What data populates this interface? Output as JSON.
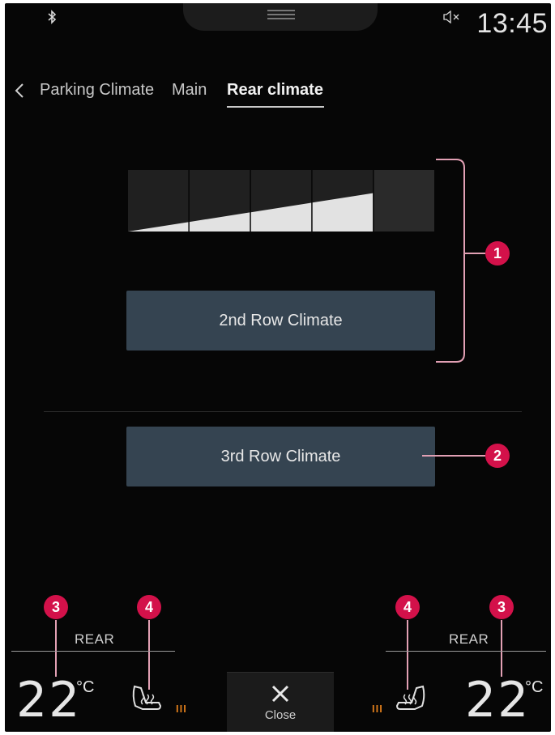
{
  "status": {
    "time": "13:45",
    "bluetooth_icon": "bluetooth-icon",
    "mute_icon": "volume-muted-icon"
  },
  "tabs": [
    {
      "label": "Parking Climate",
      "active": false
    },
    {
      "label": "Main",
      "active": false
    },
    {
      "label": "Rear climate",
      "active": true
    }
  ],
  "fan": {
    "segments": 5,
    "level": 4
  },
  "buttons": {
    "second_row": "2nd Row Climate",
    "third_row": "3rd Row Climate",
    "close": "Close"
  },
  "rear_left": {
    "label": "REAR",
    "temp": "22",
    "unit": "°C",
    "heat": "III"
  },
  "rear_right": {
    "label": "REAR",
    "temp": "22",
    "unit": "°C",
    "heat": "III"
  },
  "callouts": [
    "1",
    "2",
    "3",
    "4",
    "4",
    "3"
  ],
  "colors": {
    "background": "#060606",
    "button": "#354451",
    "callout": "#d3114a",
    "heat": "#d97a1a"
  }
}
